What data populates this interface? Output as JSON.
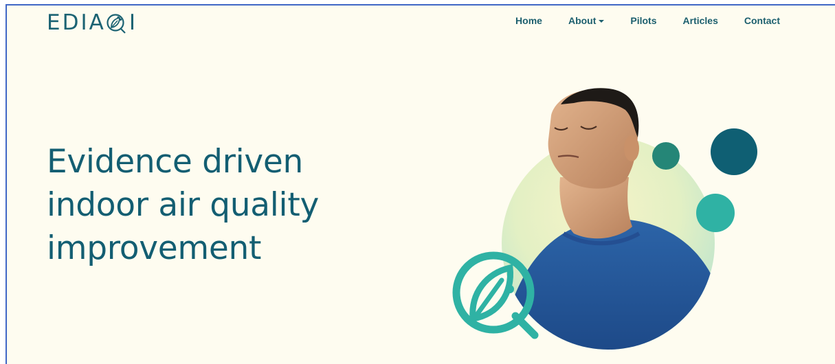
{
  "brand": {
    "logo_prefix": "EDIA",
    "logo_suffix": "I",
    "logo_mark_icon": "leaf-q-icon",
    "color_primary": "#135e72",
    "color_teal": "#2fb2a4",
    "color_dark_teal": "#0f5f73",
    "color_background": "#fefcf0"
  },
  "nav": {
    "items": [
      {
        "label": "Home"
      },
      {
        "label": "About",
        "has_dropdown": true,
        "dropdown_icon": "caret-down-icon"
      },
      {
        "label": "Pilots"
      },
      {
        "label": "Articles"
      },
      {
        "label": "Contact"
      }
    ]
  },
  "hero": {
    "title": "Evidence driven indoor air quality improvement",
    "image": "person-breathing-photo",
    "decoration_icon": "leaf-q-icon"
  }
}
